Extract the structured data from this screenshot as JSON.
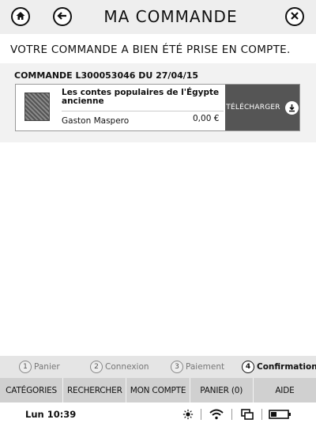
{
  "header": {
    "title": "MA COMMANDE",
    "icons": {
      "home": "home-icon",
      "back": "back-arrow-icon",
      "close": "close-icon"
    }
  },
  "confirmation": {
    "message": "VOTRE COMMANDE A BIEN ÉTÉ PRISE EN COMPTE."
  },
  "order": {
    "title": "COMMANDE L300053046 DU 27/04/15",
    "item": {
      "title": "Les contes populaires de l'Égypte ancienne",
      "author": "Gaston Maspero",
      "price": "0,00 €",
      "download_label": "TÉLÉCHARGER"
    }
  },
  "steps": [
    {
      "number": "1",
      "label": "Panier",
      "active": false
    },
    {
      "number": "2",
      "label": "Connexion",
      "active": false
    },
    {
      "number": "3",
      "label": "Paiement",
      "active": false
    },
    {
      "number": "4",
      "label": "Confirmation",
      "active": true
    }
  ],
  "nav": [
    {
      "label": "CATÉGORIES"
    },
    {
      "label": "RECHERCHER"
    },
    {
      "label": "MON COMPTE"
    },
    {
      "label": "PANIER (0)"
    },
    {
      "label": "AIDE"
    }
  ],
  "status": {
    "time": "Lun 10:39",
    "icons": [
      "brightness-icon",
      "wifi-icon",
      "sync-icon",
      "battery-icon"
    ]
  }
}
